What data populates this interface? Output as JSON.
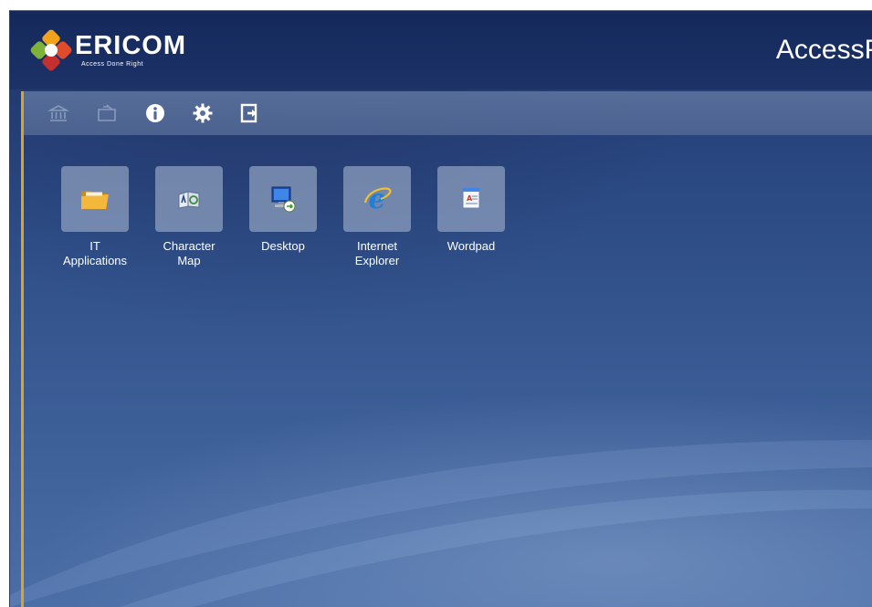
{
  "header": {
    "brand_name": "ERICOM",
    "brand_tagline": "Access Done Right",
    "app_title": "AccessPad"
  },
  "toolbar": {
    "buttons": [
      {
        "name": "home",
        "icon": "bank-icon",
        "enabled": false
      },
      {
        "name": "folder",
        "icon": "folder-up-icon",
        "enabled": false
      },
      {
        "name": "info",
        "icon": "info-icon",
        "enabled": true
      },
      {
        "name": "settings",
        "icon": "gear-icon",
        "enabled": true
      },
      {
        "name": "logout",
        "icon": "logout-icon",
        "enabled": true
      }
    ]
  },
  "apps": [
    {
      "label_line1": "IT",
      "label_line2": "Applications",
      "icon": "folder-icon"
    },
    {
      "label_line1": "Character",
      "label_line2": "Map",
      "icon": "character-map-icon"
    },
    {
      "label_line1": "Desktop",
      "label_line2": "",
      "icon": "remote-desktop-icon"
    },
    {
      "label_line1": "Internet",
      "label_line2": "Explorer",
      "icon": "internet-explorer-icon"
    },
    {
      "label_line1": "Wordpad",
      "label_line2": "",
      "icon": "wordpad-icon"
    }
  ],
  "colors": {
    "header_bg": "#14285a",
    "accent": "#d9a427",
    "background": "#2d4c86"
  }
}
